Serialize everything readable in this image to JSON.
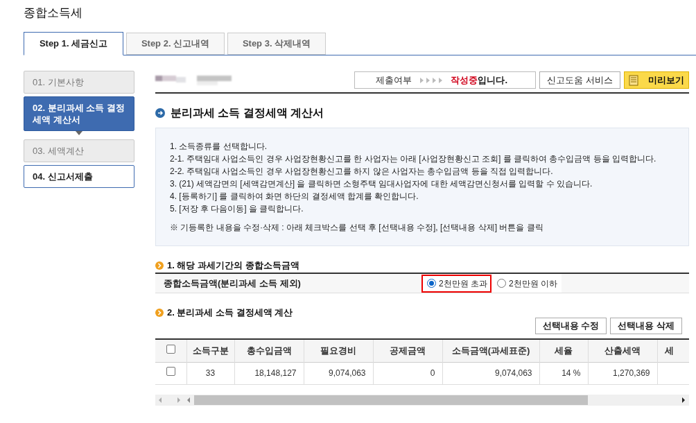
{
  "title": "종합소득세",
  "tabs": [
    {
      "label": "Step 1. 세금신고",
      "selected": true
    },
    {
      "label": "Step 2. 신고내역",
      "selected": false
    },
    {
      "label": "Step 3. 삭제내역",
      "selected": false
    }
  ],
  "steps": [
    {
      "label": "01. 기본사항",
      "selected": false,
      "disabled": true
    },
    {
      "label": "02. 분리과세 소득 결정세액 계산서",
      "selected": true,
      "disabled": false
    },
    {
      "label": "03. 세액계산",
      "selected": false,
      "disabled": true
    },
    {
      "label": "04. 신고서제출",
      "selected": false,
      "disabled": false
    }
  ],
  "status": {
    "label": "제출여부",
    "value": "작성중",
    "suffix": "입니다."
  },
  "help_button": "신고도움 서비스",
  "preview_button": "미리보기",
  "heading": "분리과세 소득 결정세액 계산서",
  "instructions": [
    "1. 소득종류를 선택합니다.",
    "2-1. 주택임대 사업소득인 경우 사업장현황신고를 한 사업자는 아래 [사업장현황신고 조회] 를 클릭하여 총수입금액 등을 입력합니다.",
    "2-2. 주택임대 사업소득인 경우 사업장현황신고를 하지 않은 사업자는 총수입금액 등을 직접 입력합니다.",
    "3. (21) 세액감면의 [세액감면계산] 을 클릭하면 소형주택 임대사업자에 대한 세액감면신청서를 입력할 수 있습니다.",
    "4. [등록하기] 를 클릭하여 화면 하단의 결정세액 합계를 확인합니다.",
    "5. [저장 후 다음이동] 을 클릭합니다."
  ],
  "note": "※ 기등록한 내용을 수정·삭제 : 아래 체크박스를 선택 후 [선택내용 수정], [선택내용 삭제] 버튼을 클릭",
  "section1": {
    "title": "1. 해당 과세기간의 종합소득금액",
    "label": "종합소득금액(분리과세 소득 제외)",
    "radios": [
      {
        "label": "2천만원 초과",
        "selected": true,
        "highlighted": true
      },
      {
        "label": "2천만원 이하",
        "selected": false,
        "highlighted": false
      }
    ]
  },
  "section2": {
    "title": "2. 분리과세 소득 결정세액 계산",
    "buttons": [
      "선택내용 수정",
      "선택내용 삭제"
    ],
    "table": {
      "all_checked": false,
      "columns": [
        "소득구분",
        "총수입금액",
        "필요경비",
        "공제금액",
        "소득금액(과세표준)",
        "세율",
        "산출세액",
        "세"
      ],
      "rows": [
        {
          "checked": false,
          "cells": [
            "33",
            "18,148,127",
            "9,074,063",
            "0",
            "9,074,063",
            "14 %",
            "1,270,369",
            ""
          ]
        }
      ]
    }
  }
}
